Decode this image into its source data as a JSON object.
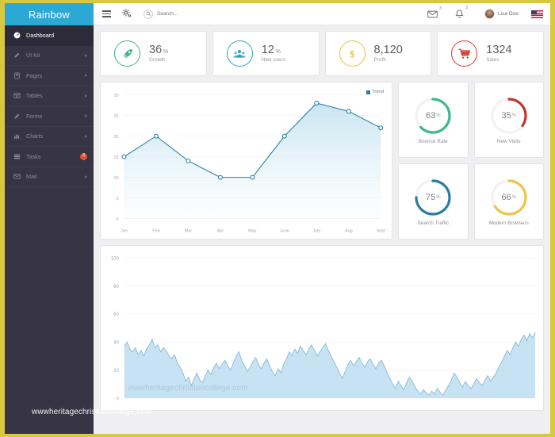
{
  "brand": {
    "name": "Rainbow"
  },
  "sidebar": {
    "items": [
      {
        "label": "Dashboard",
        "icon": "dashboard-icon",
        "active": true,
        "chevron": false,
        "badge": null
      },
      {
        "label": "UI Kit",
        "icon": "pencil-icon",
        "active": false,
        "chevron": true,
        "badge": null
      },
      {
        "label": "Pages",
        "icon": "pages-icon",
        "active": false,
        "chevron": true,
        "badge": null
      },
      {
        "label": "Tables",
        "icon": "table-icon",
        "active": false,
        "chevron": true,
        "badge": null
      },
      {
        "label": "Forms",
        "icon": "pencil-icon",
        "active": false,
        "chevron": true,
        "badge": null
      },
      {
        "label": "Charts",
        "icon": "bar-chart-icon",
        "active": false,
        "chevron": true,
        "badge": null
      },
      {
        "label": "Tasks",
        "icon": "list-icon",
        "active": false,
        "chevron": false,
        "badge": "3"
      },
      {
        "label": "Mail",
        "icon": "envelope-icon",
        "active": false,
        "chevron": true,
        "badge": null
      }
    ]
  },
  "topbar": {
    "menu_icon": "hamburger-icon",
    "settings_icon": "gear-icon",
    "search": {
      "placeholder": "Search...",
      "value": "",
      "icon": "search-icon"
    },
    "mail": {
      "icon": "envelope-icon",
      "badge": "3"
    },
    "notifications": {
      "icon": "bell-icon",
      "badge": "3"
    },
    "user": {
      "name": "Lisa Doe",
      "avatar": "user-avatar"
    },
    "language": {
      "icon": "us-flag-icon"
    }
  },
  "stats": [
    {
      "value": "36",
      "unit": "%",
      "label": "Growth",
      "icon": "rocket-icon",
      "color": "#38b48b"
    },
    {
      "value": "12",
      "unit": "%",
      "label": "New users",
      "icon": "users-icon",
      "color": "#2aa3c4"
    },
    {
      "value": "8,120",
      "unit": "",
      "label": "Profit",
      "icon": "dollar-icon",
      "color": "#e8c33c"
    },
    {
      "value": "1324",
      "unit": "",
      "label": "Sales",
      "icon": "cart-icon",
      "color": "#d9372a"
    }
  ],
  "donuts": [
    {
      "value": "63",
      "unit": "%",
      "label": "Bounce Rate",
      "color": "#3fb98a"
    },
    {
      "value": "35",
      "unit": "%",
      "label": "New Visits",
      "color": "#c0392b"
    },
    {
      "value": "75",
      "unit": "%",
      "label": "Search Traffic",
      "color": "#2b7ea1"
    },
    {
      "value": "66",
      "unit": "%",
      "label": "Modern Browsers",
      "color": "#ecc549"
    }
  ],
  "watermark": {
    "text": "wwwheritagechristiancollege.com"
  },
  "chart_data": [
    {
      "type": "line",
      "title": "",
      "categories": [
        "Jan",
        "Feb",
        "Mar",
        "Apr",
        "May",
        "June",
        "July",
        "Aug",
        "Sept"
      ],
      "series": [
        {
          "name": "Trend",
          "values": [
            15,
            20,
            14,
            10,
            10,
            20,
            28,
            26,
            22
          ],
          "color": "#2980a8"
        }
      ],
      "ylim": [
        0,
        30
      ],
      "yticks": [
        0,
        5,
        10,
        15,
        20,
        25,
        30
      ],
      "xlabel": "",
      "ylabel": "",
      "legend": [
        "Trend"
      ],
      "legend_position": "top-right",
      "grid": true,
      "fill": true
    },
    {
      "type": "area",
      "title": "",
      "ylim": [
        0,
        100
      ],
      "yticks": [
        0,
        20,
        40,
        60,
        80,
        100
      ],
      "xlabel": "",
      "ylabel": "",
      "legend": [],
      "grid": true,
      "color": "#9fcde4",
      "values": [
        37,
        40,
        35,
        33,
        36,
        31,
        34,
        30,
        35,
        38,
        42,
        36,
        38,
        33,
        36,
        34,
        30,
        28,
        31,
        25,
        22,
        18,
        12,
        15,
        9,
        14,
        18,
        13,
        11,
        16,
        20,
        17,
        22,
        25,
        21,
        24,
        27,
        23,
        20,
        25,
        30,
        33,
        27,
        23,
        19,
        22,
        26,
        29,
        24,
        21,
        25,
        28,
        23,
        19,
        16,
        21,
        18,
        24,
        28,
        33,
        30,
        35,
        32,
        37,
        34,
        31,
        35,
        38,
        34,
        30,
        33,
        36,
        39,
        34,
        30,
        26,
        22,
        18,
        14,
        19,
        24,
        27,
        23,
        26,
        29,
        25,
        22,
        26,
        28,
        24,
        21,
        25,
        27,
        23,
        18,
        14,
        10,
        7,
        12,
        9,
        6,
        11,
        15,
        12,
        8,
        5,
        3,
        6,
        4,
        2,
        5,
        3,
        7,
        4,
        2,
        6,
        9,
        13,
        18,
        15,
        11,
        8,
        12,
        9,
        7,
        10,
        14,
        11,
        9,
        13,
        16,
        12,
        15,
        18,
        22,
        26,
        30,
        34,
        31,
        36,
        40,
        37,
        42,
        45,
        41,
        46,
        43,
        47
      ]
    }
  ]
}
